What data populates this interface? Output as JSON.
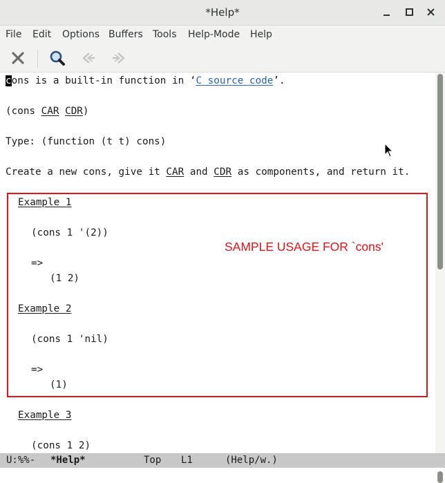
{
  "window": {
    "title": "*Help*"
  },
  "menubar": {
    "items": [
      "File",
      "Edit",
      "Options",
      "Buffers",
      "Tools",
      "Help-Mode",
      "Help"
    ]
  },
  "toolbar": {
    "icons": [
      "close-icon",
      "search-icon",
      "back-icon",
      "forward-icon"
    ]
  },
  "buffer": {
    "line1": {
      "cursor_char": "c",
      "text_a": "ons is a built-in function in ‘",
      "link": "C source code",
      "text_b": "’."
    },
    "line2": {
      "a": "(cons ",
      "car": "CAR",
      "sp": " ",
      "cdr": "CDR",
      "b": ")"
    },
    "line3": "Type: (function (t t) cons)",
    "line4": {
      "a": "Create a new cons, give it ",
      "car": "CAR",
      "b": " and ",
      "cdr": "CDR",
      "c": " as components, and return it."
    },
    "examples": [
      {
        "heading": "Example 1",
        "code": "(cons 1 '(2))",
        "arrow": "=>",
        "result": "(1 2)"
      },
      {
        "heading": "Example 2",
        "code": "(cons 1 'nil)",
        "arrow": "=>",
        "result": "(1)"
      },
      {
        "heading": "Example 3",
        "code": "(cons 1 2)"
      }
    ],
    "annotation": "SAMPLE USAGE FOR `cons'"
  },
  "modeline": {
    "state": "U:%%-",
    "buffer_name": "*Help*",
    "position": "Top",
    "line": "L1",
    "mode": "(Help/w.)"
  },
  "colors": {
    "link": "#2a62b5",
    "annotation": "#e0131a",
    "modeline_bg": "#c8c8c8"
  }
}
